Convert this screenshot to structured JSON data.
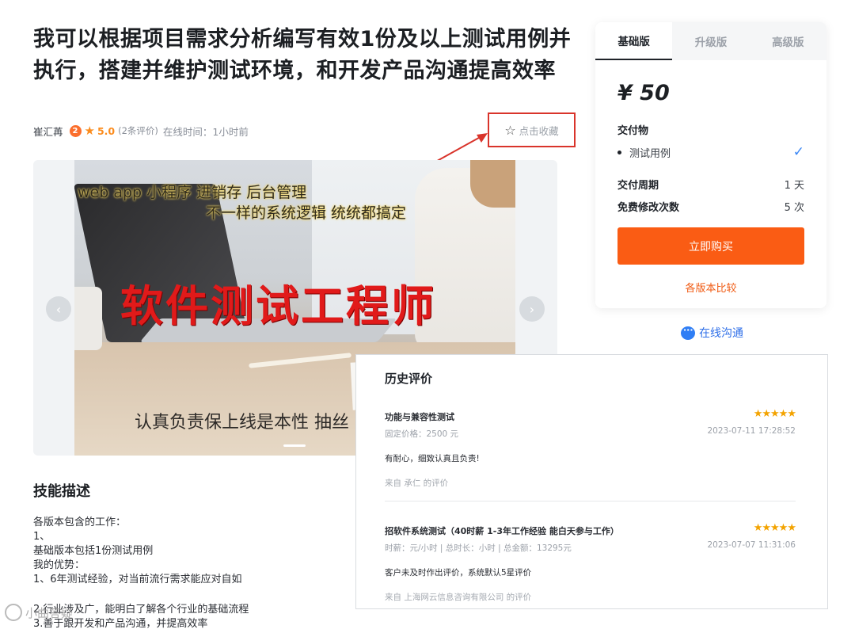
{
  "service": {
    "title": "我可以根据项目需求分析编写有效1份及以上测试用例并执行，搭建并维护测试环境，和开发产品沟通提高效率",
    "author": "崔汇苒",
    "level": "2",
    "rating": "5.0",
    "review_count": "(2条评价)",
    "online_time": "在线时间：1小时前",
    "favorite_label": "点击收藏"
  },
  "banner": {
    "line1": "web  app 小程序 进销存 后台管理",
    "line2": "不一样的系统逻辑 统统都搞定",
    "headline": "软件测试工程师",
    "bottom": "认真负责保上线是本性   抽丝"
  },
  "skills": {
    "title": "技能描述",
    "lines": [
      "各版本包含的工作：",
      "1、",
      "基础版本包括1份测试用例",
      "我的优势：",
      "1、6年测试经验，对当前流行需求能应对自如",
      "2.行业涉及广，能明白了解各个行业的基础流程",
      "3.善于跟开发和产品沟通，并提高效率"
    ]
  },
  "package_card": {
    "tabs": [
      "基础版",
      "升级版",
      "高级版"
    ],
    "active_tab": 0,
    "price": "¥ 50",
    "deliverables_label": "交付物",
    "deliverables": [
      "测试用例"
    ],
    "delivery_period_label": "交付周期",
    "delivery_period_value": "1 天",
    "revisions_label": "免费修改次数",
    "revisions_value": "5 次",
    "buy_label": "立即购买",
    "compare_label": "各版本比较",
    "accent_color": "#fa5c14"
  },
  "chat_label": "在线沟通",
  "reviews": {
    "title": "历史评价",
    "items": [
      {
        "project": "功能与兼容性测试",
        "meta": "固定价格：2500 元",
        "stars": "★★★★★",
        "date": "2023-07-11 17:28:52",
        "text": "有耐心，细致认真且负责!",
        "from": "来自 承仁 的评价"
      },
      {
        "project": "招软件系统测试（40时薪 1-3年工作经验 能白天参与工作）",
        "meta": "时薪：元/小时 | 总时长：小时 | 总金额：13295元",
        "stars": "★★★★★",
        "date": "2023-07-07 11:31:06",
        "text": "客户未及时作出评价，系统默认5星评价",
        "from": "来自 上海网云信息咨询有限公司 的评价"
      }
    ]
  },
  "watermark": "小曲答疑"
}
